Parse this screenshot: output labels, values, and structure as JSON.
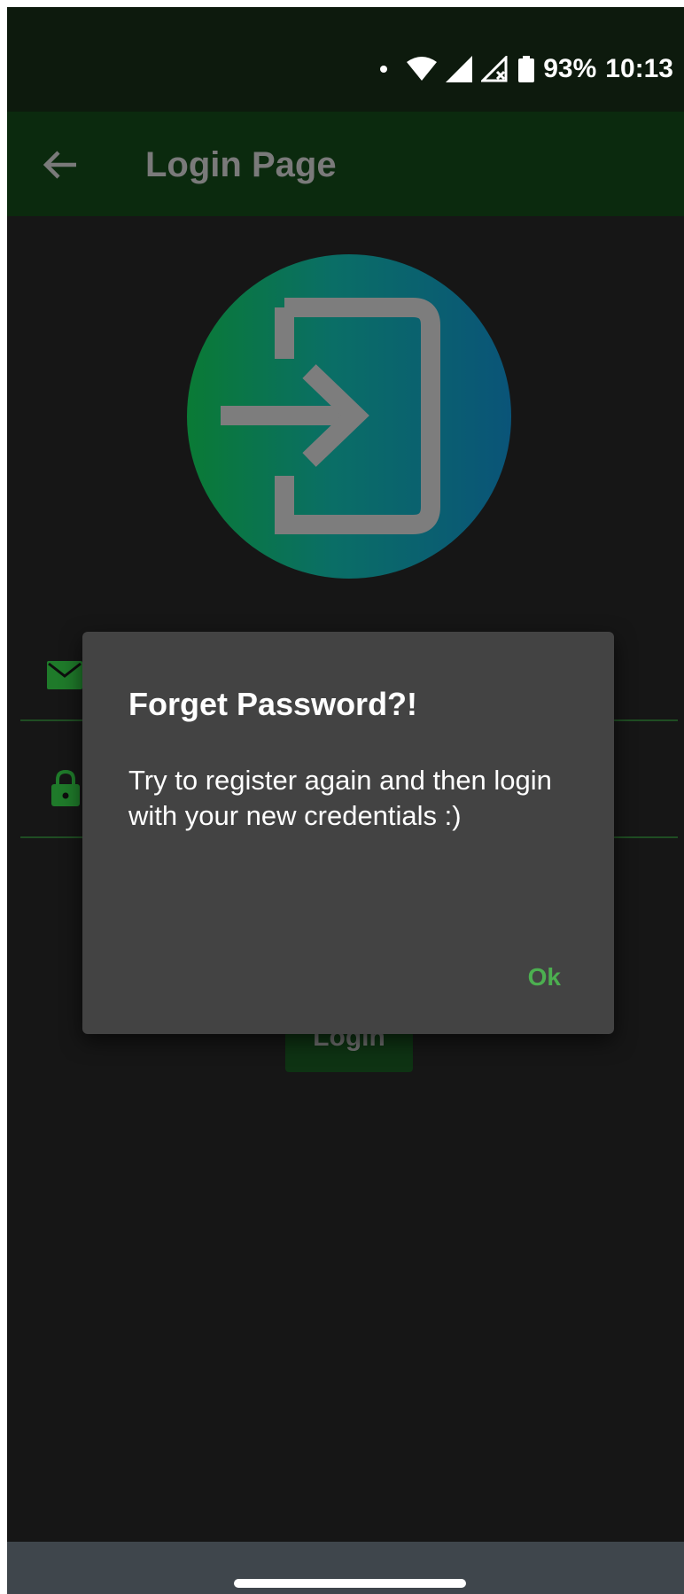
{
  "status_bar": {
    "battery_percent": "93%",
    "time": "10:13",
    "icons": [
      "notification-dot-icon",
      "wifi-icon",
      "signal-icon",
      "signal-no-data-icon",
      "battery-icon"
    ]
  },
  "app_bar": {
    "title": "Login Page",
    "back_icon": "arrow-back-icon"
  },
  "content": {
    "logo_icon": "login-icon",
    "email_icon": "mail-icon",
    "password_icon": "lock-icon",
    "login_button_label": "Login"
  },
  "dialog": {
    "title": "Forget Password?!",
    "message": "Try to register again and then login with your new credentials :)",
    "ok_label": "Ok"
  },
  "colors": {
    "accent": "#4caf50",
    "app_bar": "#0b2a0e",
    "background": "#161616",
    "dialog": "#434343"
  }
}
